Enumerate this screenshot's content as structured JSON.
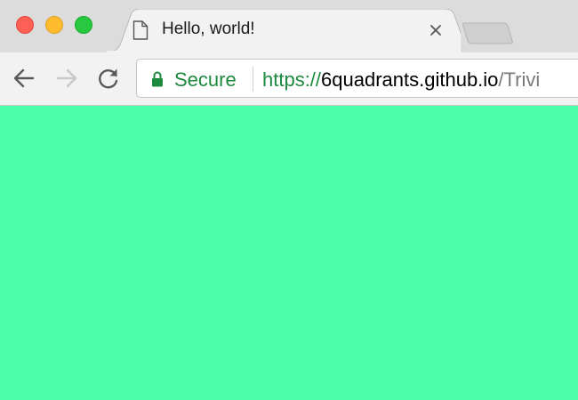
{
  "window": {
    "controls": [
      "close",
      "minimize",
      "maximize"
    ]
  },
  "tab": {
    "title": "Hello, world!",
    "icon": "page-icon"
  },
  "toolbar": {
    "back_icon": "arrow-left-icon",
    "forward_icon": "arrow-right-icon",
    "reload_icon": "reload-icon"
  },
  "omnibox": {
    "secure_label": "Secure",
    "url_scheme": "https://",
    "url_host": "6quadrants.github.io",
    "url_path": "/Trivi"
  },
  "colors": {
    "page_background": "#4bffa8",
    "secure_green": "#1e8a3e",
    "url_path_gray": "#7a7a7a"
  }
}
